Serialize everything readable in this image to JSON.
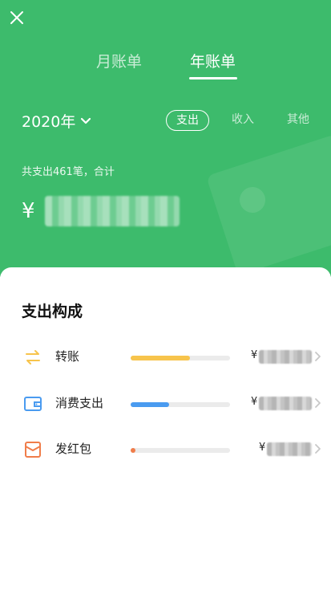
{
  "header": {
    "tabs": [
      {
        "label": "月账单",
        "active": false
      },
      {
        "label": "年账单",
        "active": true
      }
    ],
    "year": "2020年",
    "filters": [
      "支出",
      "收入",
      "其他"
    ],
    "active_filter": "支出",
    "summary": "共支出461笔，合计",
    "currency": "¥"
  },
  "breakdown": {
    "title": "支出构成",
    "items": [
      {
        "label": "转账",
        "icon": "transfer-icon",
        "fraction": 0.6,
        "color": "#f7c44c",
        "currency": "¥"
      },
      {
        "label": "消费支出",
        "icon": "wallet-icon",
        "fraction": 0.39,
        "color": "#4a9bf0",
        "currency": "¥"
      },
      {
        "label": "发红包",
        "icon": "red-packet-icon",
        "fraction": 0.05,
        "color": "#f07d4a",
        "currency": "¥"
      }
    ]
  },
  "colors": {
    "brand_green": "#3dbb6c",
    "transfer": "#f7c44c",
    "wallet": "#4a9bf0",
    "red_packet": "#f07d4a"
  }
}
